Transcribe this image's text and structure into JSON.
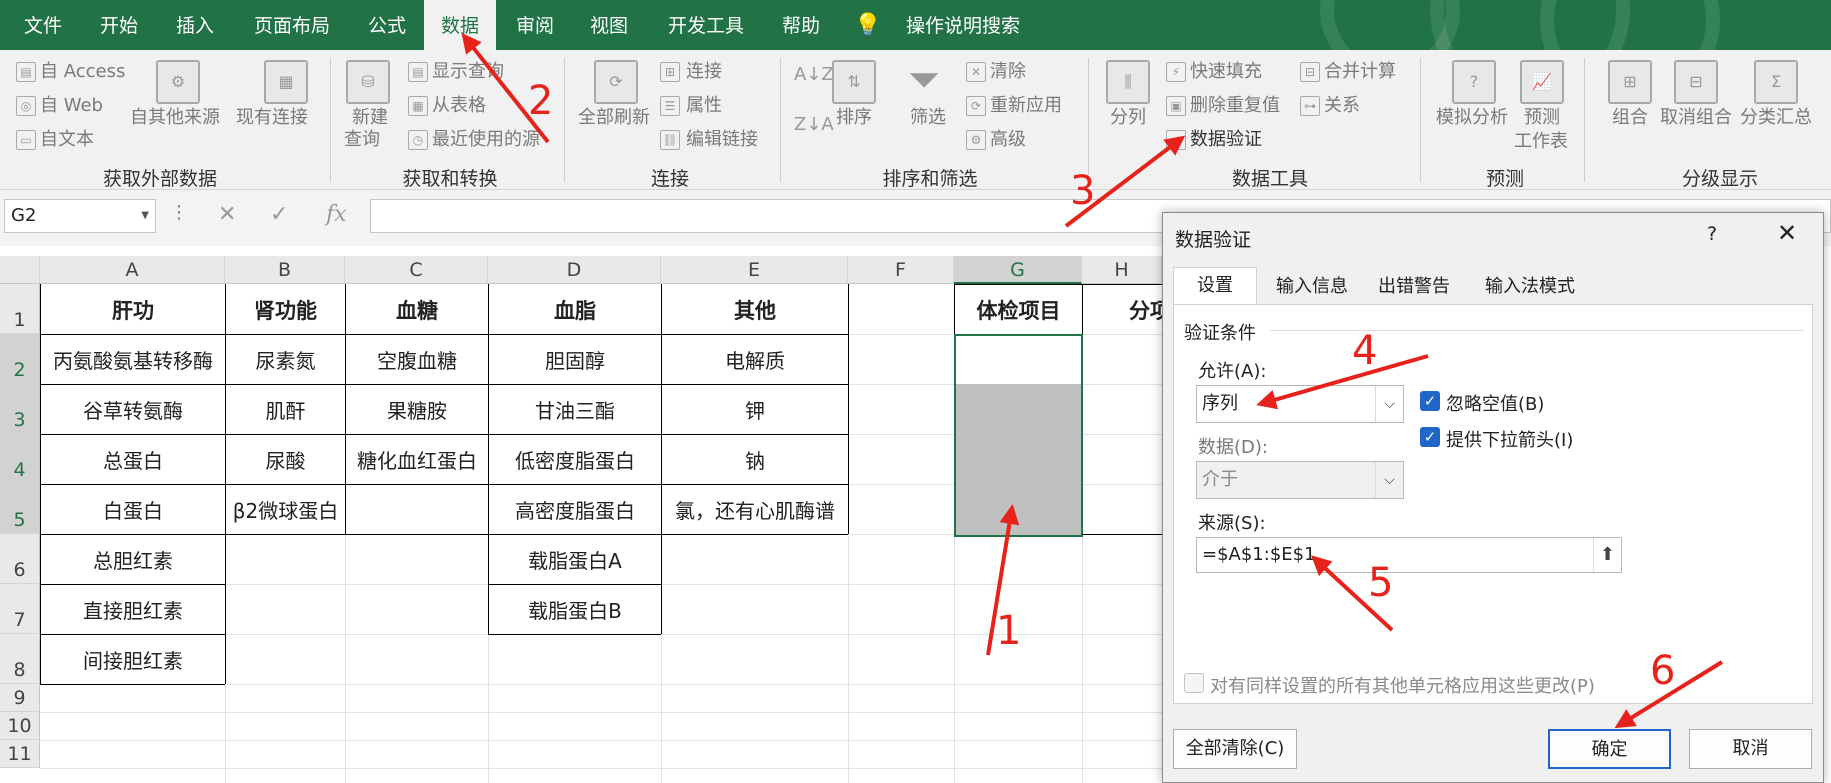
{
  "menu": {
    "items": [
      "文件",
      "开始",
      "插入",
      "页面布局",
      "公式",
      "数据",
      "审阅",
      "视图",
      "开发工具",
      "帮助"
    ],
    "active": "数据",
    "search_label": "操作说明搜索"
  },
  "ribbon": {
    "external": {
      "access": "自 Access",
      "web": "自 Web",
      "text": "自文本",
      "other": "自其他来源",
      "existing": "现有连接",
      "group": "获取外部数据"
    },
    "transform": {
      "new_query": "新建",
      "new_query2": "查询",
      "show_query": "显示查询",
      "from_table": "从表格",
      "recent": "最近使用的源",
      "group": "获取和转换"
    },
    "connections": {
      "refresh": "全部刷新",
      "connections": "连接",
      "properties": "属性",
      "edit_links": "编辑链接",
      "group": "连接"
    },
    "sort": {
      "sort": "排序",
      "filter": "筛选",
      "clear": "清除",
      "reapply": "重新应用",
      "advanced": "高级",
      "group": "排序和筛选"
    },
    "datatools": {
      "split": "分列",
      "flash_fill": "快速填充",
      "remove_dup": "删除重复值",
      "validation": "数据验证",
      "consolidate": "合并计算",
      "relations": "关系",
      "group": "数据工具"
    },
    "forecast": {
      "whatif": "模拟分析",
      "sheet": "预测",
      "sheet2": "工作表",
      "group": "预测"
    },
    "outline": {
      "group_btn": "组合",
      "ungroup": "取消组合",
      "subtotal": "分类汇总",
      "group": "分级显示"
    }
  },
  "formula_bar": {
    "name_box": "G2",
    "fx": "fx",
    "cancel": "✕",
    "enter": "✓"
  },
  "sheet": {
    "columns": [
      "A",
      "B",
      "C",
      "D",
      "E",
      "F",
      "G",
      "H"
    ],
    "rows": [
      "1",
      "2",
      "3",
      "4",
      "5",
      "6",
      "7",
      "8",
      "9",
      "10",
      "11"
    ],
    "headers": {
      "A": "肝功",
      "B": "肾功能",
      "C": "血糖",
      "D": "血脂",
      "E": "其他",
      "G": "体检项目",
      "H": "分项"
    },
    "colA": [
      "丙氨酸氨基转移酶",
      "谷草转氨酶",
      "总蛋白",
      "白蛋白",
      "总胆红素",
      "直接胆红素",
      "间接胆红素"
    ],
    "colB": [
      "尿素氮",
      "肌酐",
      "尿酸",
      "β2微球蛋白"
    ],
    "colC": [
      "空腹血糖",
      "果糖胺",
      "糖化血红蛋白"
    ],
    "colD": [
      "胆固醇",
      "甘油三酯",
      "低密度脂蛋白",
      "高密度脂蛋白",
      "载脂蛋白A",
      "载脂蛋白B"
    ],
    "colE": [
      "电解质",
      "钾",
      "钠",
      "氯，还有心肌酶谱"
    ]
  },
  "dialog": {
    "title": "数据验证",
    "help": "?",
    "close": "✕",
    "tabs": [
      "设置",
      "输入信息",
      "出错警告",
      "输入法模式"
    ],
    "criteria": "验证条件",
    "allow_label": "允许(A):",
    "allow_value": "序列",
    "ignore_blank": "忽略空值(B)",
    "dropdown": "提供下拉箭头(I)",
    "data_label": "数据(D):",
    "data_value": "介于",
    "source_label": "来源(S):",
    "source_value": "=$A$1:$E$1",
    "apply_all": "对有同样设置的所有其他单元格应用这些更改(P)",
    "clear_all": "全部清除(C)",
    "ok": "确定",
    "cancel": "取消"
  },
  "annotations": [
    "1",
    "2",
    "3",
    "4",
    "5",
    "6"
  ],
  "colors": {
    "excel_green": "#217346",
    "annotation_red": "#e6221b",
    "checkbox_blue": "#1e66c7"
  }
}
